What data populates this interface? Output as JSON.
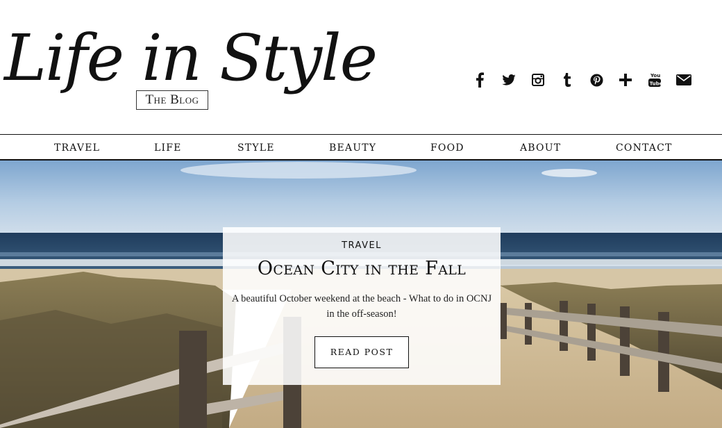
{
  "header": {
    "logo_script": "Life in Style",
    "logo_badge": "The Blog",
    "social_icons": [
      "facebook-icon",
      "twitter-icon",
      "instagram-icon",
      "tumblr-icon",
      "pinterest-icon",
      "google-plus-icon",
      "youtube-icon",
      "email-icon"
    ]
  },
  "nav": {
    "items": [
      "TRAVEL",
      "LIFE",
      "STYLE",
      "BEAUTY",
      "FOOD",
      "ABOUT",
      "CONTACT"
    ]
  },
  "featured": {
    "category": "TRAVEL",
    "title": "Ocean City in the Fall",
    "excerpt": "A beautiful October weekend at the beach - What to do in OCNJ in the off-season!",
    "button_label": "READ POST"
  },
  "colors": {
    "text": "#111111",
    "sky": "#b8cfe4",
    "ocean": "#2b4a68",
    "sand": "#cdb894",
    "dune_grass": "#6e6244",
    "fence": "#4a4038"
  }
}
